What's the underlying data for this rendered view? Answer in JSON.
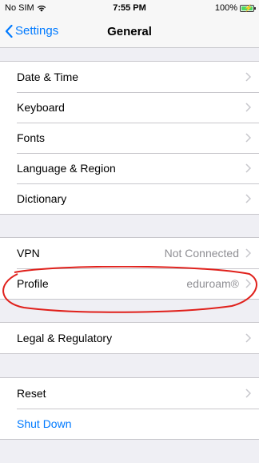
{
  "status_bar": {
    "carrier": "No SIM",
    "time": "7:55 PM",
    "battery_percent_text": "100%",
    "battery_level": 1.0
  },
  "nav": {
    "back_label": "Settings",
    "title": "General"
  },
  "groups": [
    {
      "rows": [
        {
          "label": "Date & Time"
        },
        {
          "label": "Keyboard"
        },
        {
          "label": "Fonts"
        },
        {
          "label": "Language & Region"
        },
        {
          "label": "Dictionary"
        }
      ]
    },
    {
      "rows": [
        {
          "label": "VPN",
          "value": "Not Connected"
        },
        {
          "label": "Profile",
          "value": "eduroam®"
        }
      ]
    },
    {
      "rows": [
        {
          "label": "Legal & Regulatory"
        }
      ]
    },
    {
      "rows": [
        {
          "label": "Reset"
        },
        {
          "label": "Shut Down"
        }
      ]
    }
  ],
  "colors": {
    "accent": "#007aff",
    "annotation": "#e0201b",
    "background": "#efeff4",
    "separator": "#c8c7cc",
    "secondary_text": "#8e8e93"
  },
  "annotation": {
    "shape": "ellipse",
    "highlights": "Profile row"
  }
}
